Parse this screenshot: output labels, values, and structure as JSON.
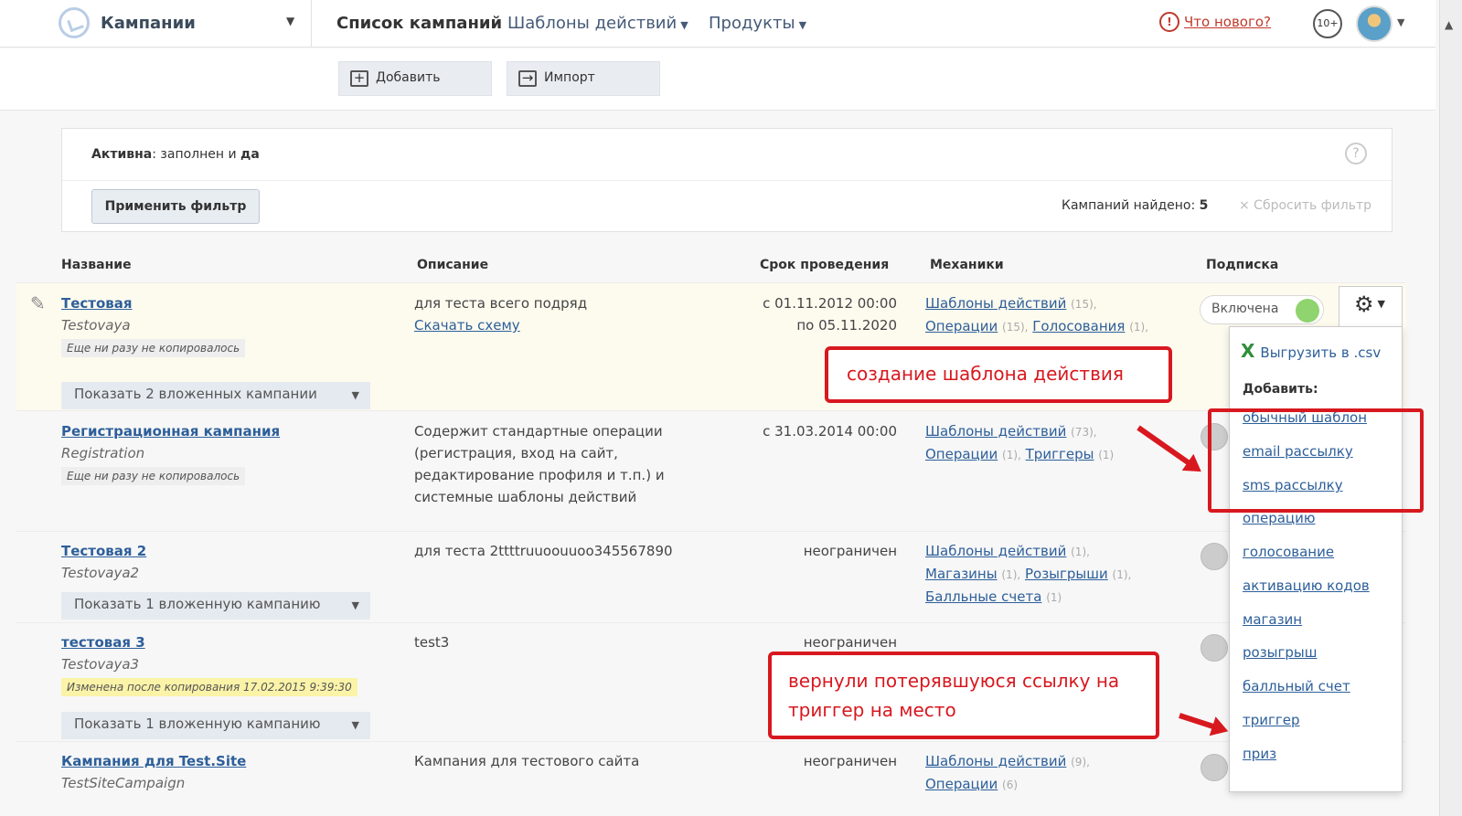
{
  "header": {
    "app_title": "Кампании",
    "nav": {
      "list": "Список кампаний",
      "templates": "Шаблоны действий",
      "products": "Продукты"
    },
    "whats_new": "Что нового?",
    "notifications": "10+"
  },
  "toolbar": {
    "add_label": "Добавить",
    "import_label": "Импорт"
  },
  "filter": {
    "field": "Активна",
    "text": ": заполнен и ",
    "value": "да",
    "apply_label": "Применить фильтр",
    "found_label": "Кампаний найдено: ",
    "found_count": "5",
    "reset_label": "× Сбросить фильтр"
  },
  "table": {
    "headers": [
      "Название",
      "Описание",
      "Срок проведения",
      "Механики",
      "Подписка"
    ],
    "rows": [
      {
        "name": "Тестовая",
        "alias": "Testovaya",
        "copy_note": "Еще ни разу не копировалось",
        "sub_button": "Показать 2 вложенных кампании",
        "desc": "для теста всего подряд",
        "desc_link": "Скачать схему",
        "period_1": "с 01.11.2012 00:00",
        "period_2": "по 05.11.2020",
        "mech": [
          {
            "label": "Шаблоны действий",
            "count": "(15),"
          },
          {
            "label": "Операции",
            "count": "(15),"
          },
          {
            "label": "Голосования",
            "count": "(1),"
          }
        ],
        "subscription": "Включена"
      },
      {
        "name": "Регистрационная кампания",
        "alias": "Registration",
        "copy_note": "Еще ни разу не копировалось",
        "desc_lines": [
          "Содержит стандартные операции",
          "(регистрация, вход на сайт,",
          "редактирование профиля и т.п.) и",
          "системные шаблоны действий"
        ],
        "period_1": "с 31.03.2014 00:00",
        "mech": [
          {
            "label": "Шаблоны действий",
            "count": "(73),"
          },
          {
            "label": "Операции",
            "count": "(1),"
          },
          {
            "label": "Триггеры",
            "count": "(1)"
          }
        ]
      },
      {
        "name": "Тестовая 2",
        "alias": "Testovaya2",
        "sub_button": "Показать 1 вложенную кампанию",
        "desc": "для теста 2ttttruuoouuoo345567890",
        "period_1": "неограничен",
        "mech": [
          {
            "label": "Шаблоны действий",
            "count": "(1),"
          },
          {
            "label": "Магазины",
            "count": "(1),"
          },
          {
            "label": "Розыгрыши",
            "count": "(1),"
          },
          {
            "label": "Балльные счета",
            "count": "(1)"
          }
        ]
      },
      {
        "name": "тестовая 3",
        "alias": "Testovaya3",
        "copy_note": "Изменена после копирования 17.02.2015 9:39:30",
        "sub_button": "Показать 1 вложенную кампанию",
        "desc": "test3",
        "period_1": "неограничен"
      },
      {
        "name": "Кампания для Test.Site",
        "alias": "TestSiteCampaign",
        "desc": "Кампания для тестового сайта",
        "period_1": "неограничен",
        "mech": [
          {
            "label": "Шаблоны действий",
            "count": "(9),"
          },
          {
            "label": "Операции",
            "count": "(6)"
          }
        ]
      }
    ]
  },
  "dropdown": {
    "csv": "Выгрузить в .csv",
    "add_title": "Добавить:",
    "items": [
      "обычный шаблон",
      "email рассылку",
      "sms рассылку",
      "операцию",
      "голосование",
      "активацию кодов",
      "магазин",
      "розыгрыш",
      "балльный счет",
      "триггер",
      "приз"
    ]
  },
  "annotations": {
    "first": "создание шаблона действия",
    "second": "вернули потерявшуюся ссылку на триггер на место"
  },
  "colors": {
    "link": "#2d5f9a",
    "annotation": "#d8181f",
    "toggle_on": "#8fd46e"
  }
}
